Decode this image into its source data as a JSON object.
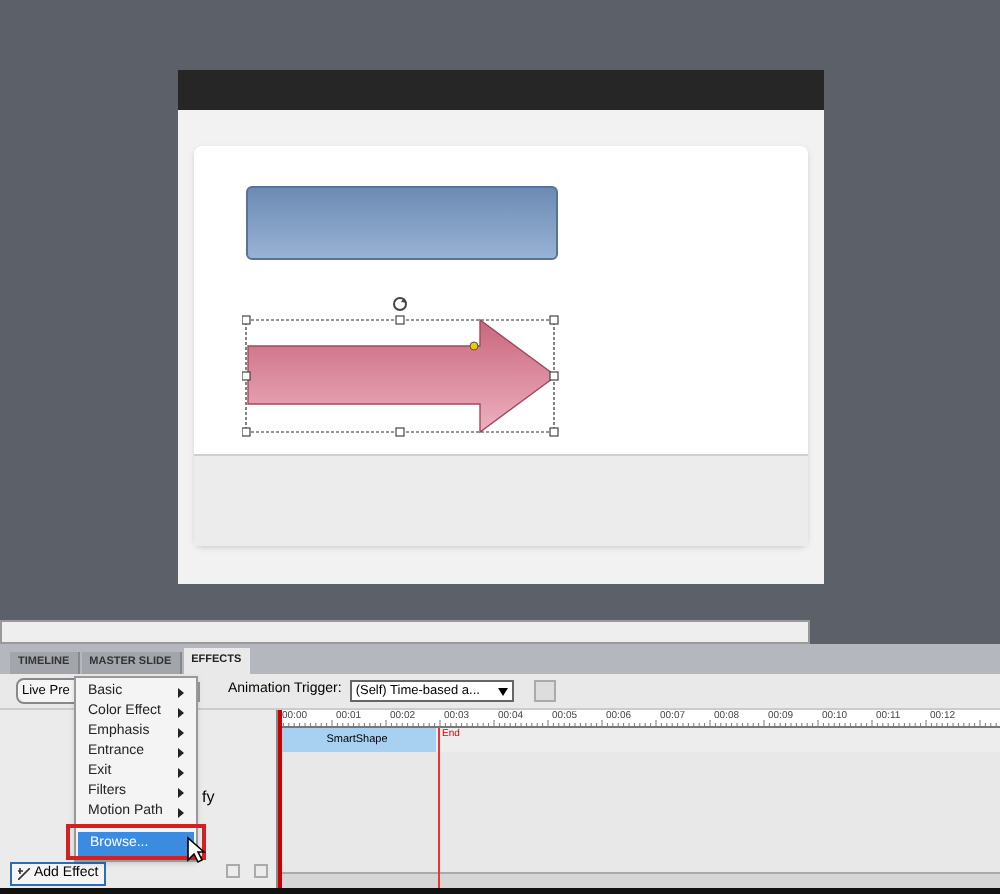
{
  "stage": {
    "shapes": [
      {
        "kind": "rectangle",
        "selected": false
      },
      {
        "kind": "arrow",
        "selected": true
      }
    ]
  },
  "tabs": [
    {
      "label": "TIMELINE",
      "selected": false
    },
    {
      "label": "MASTER SLIDE",
      "selected": false
    },
    {
      "label": "EFFECTS",
      "selected": true
    }
  ],
  "toolbar": {
    "live_preview": "Live Pre",
    "trigger_label": "Animation Trigger:",
    "trigger_value": "(Self) Time-based a..."
  },
  "timeline": {
    "ticks": [
      "00:00",
      "00:01",
      "00:02",
      "00:03",
      "00:04",
      "00:05",
      "00:06",
      "00:07",
      "00:08",
      "00:09",
      "00:10",
      "00:11",
      "00:12"
    ],
    "end_label": "End",
    "bar_label": "SmartShape"
  },
  "effects_panel": {
    "partial_text": "fy",
    "add_button": "Add Effect"
  },
  "menu": {
    "items": [
      {
        "label": "Basic",
        "submenu": true,
        "selected": false
      },
      {
        "label": "Color Effect",
        "submenu": true,
        "selected": false
      },
      {
        "label": "Emphasis",
        "submenu": true,
        "selected": false
      },
      {
        "label": "Entrance",
        "submenu": true,
        "selected": false
      },
      {
        "label": "Exit",
        "submenu": true,
        "selected": false
      },
      {
        "label": "Filters",
        "submenu": true,
        "selected": false
      },
      {
        "label": "Motion Path",
        "submenu": true,
        "selected": false
      },
      {
        "label": "Browse...",
        "submenu": false,
        "selected": true
      }
    ]
  }
}
